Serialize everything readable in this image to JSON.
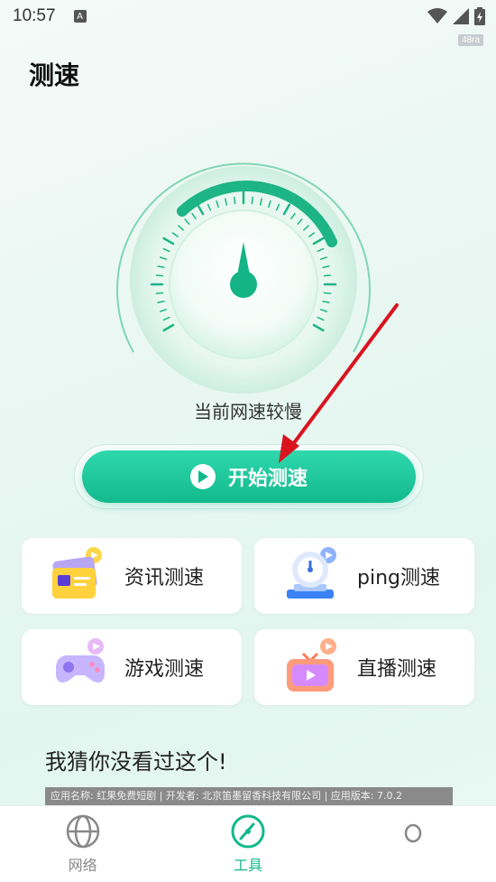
{
  "status_bar": {
    "time": "10:57",
    "badge_letter": "A",
    "corner_tag": "48ra"
  },
  "header": {
    "title": "测速"
  },
  "gauge": {
    "status_text": "当前网速较慢",
    "progress_fraction": 0.35
  },
  "start_button": {
    "label": "开始测速"
  },
  "cards": [
    {
      "label": "资讯测速",
      "icon": "news-card-icon"
    },
    {
      "label": "ping测速",
      "icon": "ping-scale-icon"
    },
    {
      "label": "游戏测速",
      "icon": "gamepad-icon"
    },
    {
      "label": "直播测速",
      "icon": "tv-live-icon"
    }
  ],
  "recommend": {
    "title": "我猜你没看过这个!",
    "ad_text": "应用名称: 红果免费短剧 | 开发者: 北京笛墨留香科技有限公司 | 应用版本: 7.0.2"
  },
  "bottom_nav": [
    {
      "label": "网络",
      "active": false
    },
    {
      "label": "工具",
      "active": true
    }
  ],
  "colors": {
    "accent": "#12b98c",
    "accent_light": "#2fd8ad",
    "arrow": "#d9141f"
  }
}
